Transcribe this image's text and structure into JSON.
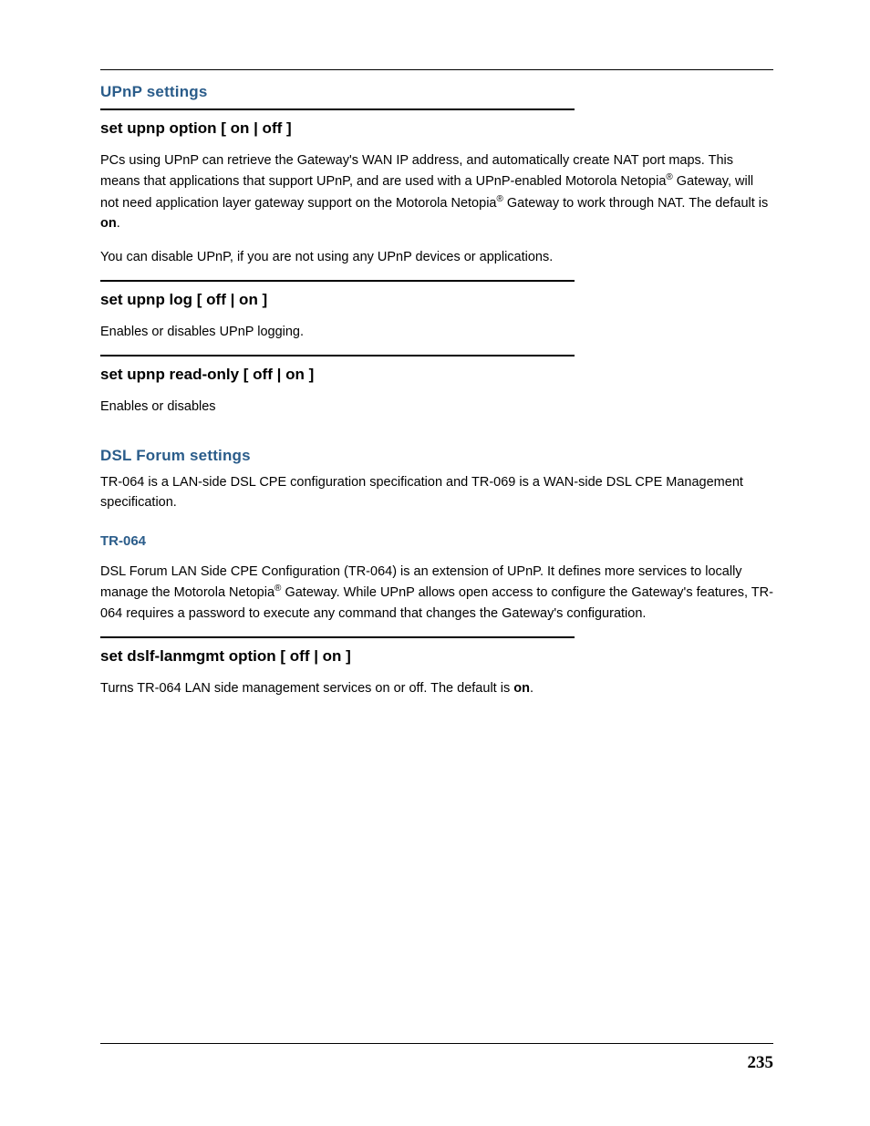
{
  "section1": {
    "heading": "UPnP settings",
    "cmd1": {
      "title": "set upnp option [ on | off ]",
      "para1_a": "PCs using UPnP can retrieve the Gateway's WAN IP address, and automatically create NAT port maps. This means that applications that support UPnP, and are used with a UPnP-enabled Motorola Netopia",
      "para1_b": " Gateway, will not need application layer gateway support on the Motorola Netopia",
      "para1_c": " Gateway to work through NAT. The default is ",
      "para1_bold": "on",
      "para1_d": ".",
      "para2": "You can disable UPnP, if you are not using any UPnP devices or applications."
    },
    "cmd2": {
      "title": "set upnp log [ off | on ]",
      "para": "Enables or disables UPnP logging."
    },
    "cmd3": {
      "title": "set upnp read-only [ off | on ]",
      "para": "Enables or disables"
    }
  },
  "section2": {
    "heading": "DSL Forum settings",
    "intro": "TR-064 is a LAN-side DSL CPE configuration specification and TR-069 is a WAN-side DSL CPE Management specification.",
    "sub1": {
      "heading": "TR-064",
      "para_a": "DSL Forum LAN Side CPE Configuration (TR-064) is an extension of UPnP. It defines more services to locally manage the Motorola Netopia",
      "para_b": " Gateway. While UPnP allows open access to configure the Gateway's features, TR-064 requires a password to execute any command that changes the Gateway's configuration."
    },
    "cmd1": {
      "title": "set dslf-lanmgmt option [ off | on ]",
      "para_a": "Turns TR-064 LAN side management services on or off. The default is ",
      "para_bold": "on",
      "para_b": "."
    }
  },
  "pageNumber": "235",
  "reg": "®"
}
